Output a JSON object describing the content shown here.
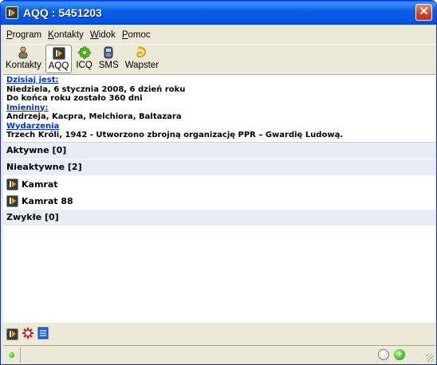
{
  "window": {
    "title": "AQQ : 5451203",
    "close_label": "✕"
  },
  "menu": {
    "items": [
      {
        "mnemonic": "P",
        "rest": "rogram"
      },
      {
        "mnemonic": "K",
        "rest": "ontakty"
      },
      {
        "mnemonic": "W",
        "rest": "idok"
      },
      {
        "mnemonic": "P",
        "rest": "omoc"
      }
    ]
  },
  "toolbar": {
    "items": [
      {
        "label": "Kontakty",
        "icon": "contacts-icon"
      },
      {
        "label": "AQQ",
        "icon": "aqq-icon",
        "active": true
      },
      {
        "label": "ICQ",
        "icon": "icq-flower-icon"
      },
      {
        "label": "SMS",
        "icon": "phone-icon"
      },
      {
        "label": "Wapster",
        "icon": "wapster-icon"
      }
    ]
  },
  "info": {
    "today_label": "Dzisiaj jest:",
    "today_text": "Niedziela, 6 stycznia 2008, 6 dzień roku",
    "days_left": "Do końca roku zostało 360 dni",
    "names_label": "Imieniny:",
    "names_text": "Andrzeja, Kacpra, Melchiora, Baltazara",
    "events_label": "Wydarzenia",
    "events_text": "Trzech Króli, 1942 - Utworzono zbrojną organizację PPR – Gwardię Ludową."
  },
  "groups": {
    "active": "Aktywne [0]",
    "inactive": "Nieaktywne [2]",
    "contacts": [
      "Kamrat",
      "Kamrat 88"
    ],
    "normal": "Zwykłe [0]"
  },
  "colors": {
    "title_bar": "#0354e2",
    "link": "#0033cc",
    "group_bg": "#e9ecf4",
    "accent": "#f0a400"
  }
}
